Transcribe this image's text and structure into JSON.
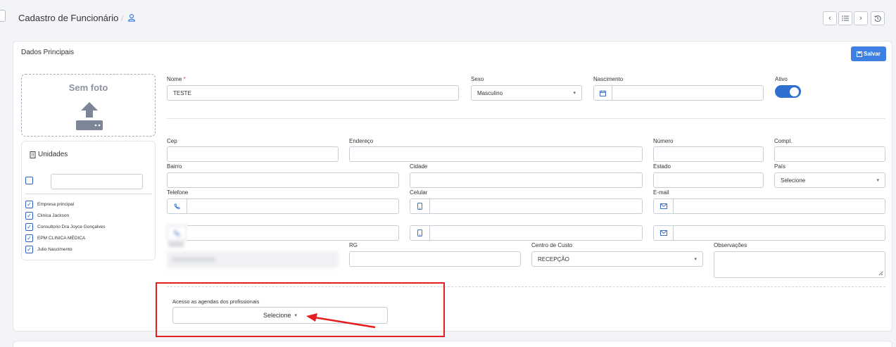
{
  "header": {
    "title": "Cadastro de Funcionário",
    "separator": "/",
    "icons": [
      "user-icon"
    ],
    "nav_buttons": [
      "chevron-left-icon",
      "list-icon",
      "chevron-right-icon",
      "history-icon"
    ]
  },
  "section": {
    "title": "Dados Principais",
    "save_label": "Salvar"
  },
  "photo": {
    "label": "Sem foto",
    "icon": "upload-icon"
  },
  "units": {
    "title": "Unidades",
    "icon": "building-icon",
    "filter_value": "",
    "items": [
      {
        "label": "Empresa principal",
        "checked": true
      },
      {
        "label": "Clinica Jackson",
        "checked": true
      },
      {
        "label": "Consultorio Dra Joyce Gonçalves",
        "checked": true
      },
      {
        "label": "EPM CLINICA MÉDICA",
        "checked": true
      },
      {
        "label": "Julio Nascimento",
        "checked": true
      }
    ]
  },
  "form": {
    "nome": {
      "label": "Nome",
      "required_mark": "*",
      "value": "TESTE"
    },
    "sexo": {
      "label": "Sexo",
      "value": "Masculino"
    },
    "nascimento": {
      "label": "Nascimento",
      "value": "",
      "icon": "calendar-icon"
    },
    "ativo": {
      "label": "Ativo",
      "on": true
    },
    "cep": {
      "label": "Cep",
      "value": ""
    },
    "endereco": {
      "label": "Endereço",
      "value": ""
    },
    "numero": {
      "label": "Número",
      "value": ""
    },
    "compl": {
      "label": "Compl.",
      "value": ""
    },
    "bairro": {
      "label": "Bairro",
      "value": ""
    },
    "cidade": {
      "label": "Cidade",
      "value": ""
    },
    "estado": {
      "label": "Estado",
      "value": ""
    },
    "pais": {
      "label": "País",
      "value": "Selecione"
    },
    "telefone": {
      "label": "Telefone",
      "icon": "phone-icon"
    },
    "celular": {
      "label": "Celular",
      "icon": "mobile-icon"
    },
    "email": {
      "label": "E-mail",
      "icon": "envelope-icon"
    },
    "rg": {
      "label": "RG",
      "value": ""
    },
    "centro_custo": {
      "label": "Centro de Custo",
      "value": "RECEPÇÃO"
    },
    "observacoes": {
      "label": "Observações",
      "value": ""
    },
    "agendas": {
      "label": "Acesso as agendas dos profissionais",
      "value": "Selecione"
    }
  },
  "colors": {
    "accent": "#3d7fe2",
    "highlight_box": "#e41e1e",
    "toggle_on": "#2f6fd0"
  }
}
